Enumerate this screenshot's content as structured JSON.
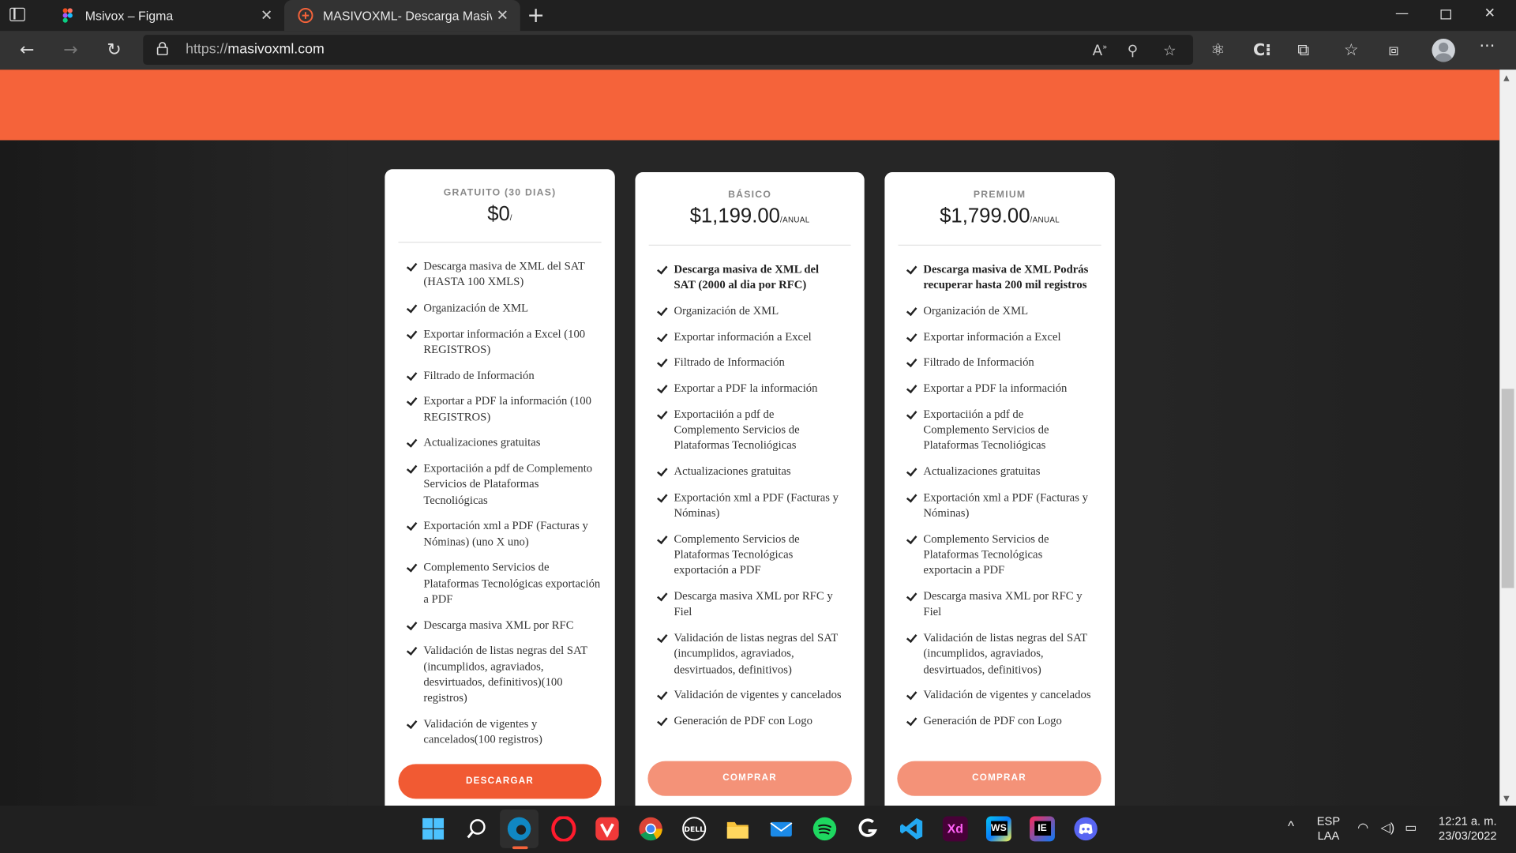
{
  "browser": {
    "tabs": [
      {
        "title": "Msivox – Figma"
      },
      {
        "title": "MASIVOXML- Descarga Masiva XML"
      }
    ],
    "url_prefix": "https://",
    "url_domain": "masivoxml.com",
    "new_tab": "+",
    "tab_actions_icon": "tab-actions-icon",
    "icons": [
      "back-arrow-icon",
      "forward-arrow-icon",
      "refresh-icon",
      "lock-icon",
      "read-aloud-icon",
      "zoom-icon",
      "favorite-add-icon",
      "extension-icon",
      "c-icon",
      "puzzle-icon",
      "favorites-icon",
      "collections-icon",
      "profile-icon",
      "more-icon"
    ]
  },
  "pricing": {
    "plans": [
      {
        "name": "GRATUITO (30 DIAS)",
        "price": "$0",
        "period": "/",
        "features": [
          "Descarga masiva de XML del SAT (HASTA 100 XMLS)",
          "Organización de XML",
          "Exportar información a Excel (100 REGISTROS)",
          "Filtrado de Información",
          "Exportar a PDF la información (100 REGISTROS)",
          "Actualizaciones gratuitas",
          "Exportaciión a pdf de Complemento Servicios de Plataformas Tecnoliógicas",
          "Exportación xml a PDF (Facturas y Nóminas) (uno X uno)",
          "Complemento Servicios de Plataformas Tecnológicas exportación a PDF",
          "Descarga masiva XML por RFC",
          "Validación de listas negras del SAT (incumplidos, agraviados, desvirtuados, definitivos)(100 registros)",
          "Validación de vigentes y cancelados(100 registros)"
        ],
        "button": "DESCARGAR",
        "button_color": "#f15a33"
      },
      {
        "name": "BÁSICO",
        "price": "$1,199.00",
        "period": "/ANUAL",
        "features": [
          "Descarga masiva de XML del SAT (2000 al dia por RFC)",
          "Organización de XML",
          "Exportar información a Excel",
          "Filtrado de Información",
          "Exportar a PDF la información",
          "Exportaciión a pdf de Complemento Servicios de Plataformas Tecnoliógicas",
          "Actualizaciones gratuitas",
          "Exportación xml a PDF (Facturas y Nóminas)",
          "Complemento Servicios de Plataformas Tecnológicas exportación a PDF",
          "Descarga masiva XML por RFC y Fiel",
          "Validación de listas negras del SAT (incumplidos, agraviados, desvirtuados, definitivos)",
          "Validación de vigentes y cancelados",
          "Generación de PDF con Logo"
        ],
        "button": "COMPRAR",
        "button_color": "#f49278"
      },
      {
        "name": "PREMIUM",
        "price": "$1,799.00",
        "period": "/ANUAL",
        "features": [
          "Descarga masiva de XML Podrás recuperar hasta 200 mil registros",
          "Organización de XML",
          "Exportar información a Excel",
          "Filtrado de Información",
          "Exportar a PDF la información",
          "Exportaciión a pdf de Complemento Servicios de Plataformas Tecnoliógicas",
          "Actualizaciones gratuitas",
          "Exportación xml a PDF (Facturas y Nóminas)",
          "Complemento Servicios de Plataformas Tecnológicas exportacin a PDF",
          "Descarga masiva XML por RFC y Fiel",
          "Validación de listas negras del SAT (incumplidos, agraviados, desvirtuados, definitivos)",
          "Validación de vigentes y cancelados",
          "Generación de PDF con Logo"
        ],
        "button": "COMPRAR",
        "button_color": "#f49278"
      }
    ]
  },
  "taskbar": {
    "apps": [
      "start",
      "search",
      "edge",
      "opera",
      "vivaldi",
      "chrome",
      "dell",
      "file-explorer",
      "mail",
      "spotify",
      "logitech",
      "vscode",
      "Xd",
      "WS",
      "IE",
      "discord"
    ],
    "xd_label": "Xd",
    "ws_label": "WS",
    "ie_label": "IE",
    "lang_top": "ESP",
    "lang_bottom": "LAA",
    "time": "12:21 a. m.",
    "date": "23/03/2022"
  },
  "colors": {
    "banner": "#f5633a",
    "accent": "#f15a33"
  }
}
